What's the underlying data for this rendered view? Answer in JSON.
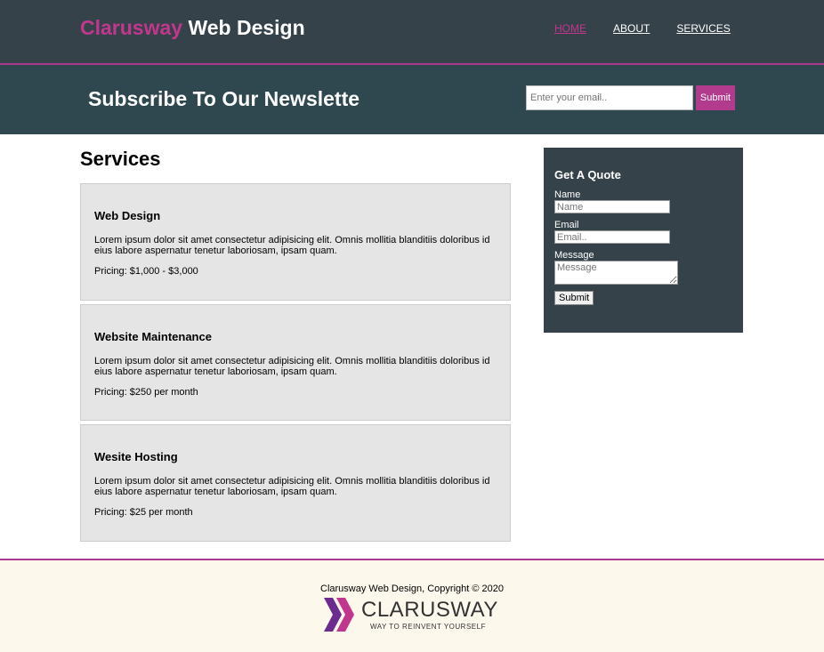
{
  "header": {
    "brand_accent": "Clarusway",
    "brand_rest": " Web Design",
    "nav": [
      {
        "label": "HOME",
        "active": true
      },
      {
        "label": "ABOUT",
        "active": false
      },
      {
        "label": "SERVICES",
        "active": false
      }
    ]
  },
  "newsletter": {
    "title": "Subscribe To Our Newslette",
    "placeholder": "Enter your email..",
    "submit_label": "Submit"
  },
  "services": {
    "title": "Services",
    "items": [
      {
        "name": "Web Design",
        "description": "Lorem ipsum dolor sit amet consectetur adipisicing elit. Omnis mollitia blanditiis doloribus id eius labore aspernatur tenetur laboriosam, ipsam quam.",
        "pricing": "Pricing: $1,000 - $3,000"
      },
      {
        "name": "Website Maintenance",
        "description": "Lorem ipsum dolor sit amet consectetur adipisicing elit. Omnis mollitia blanditiis doloribus id eius labore aspernatur tenetur laboriosam, ipsam quam.",
        "pricing": "Pricing: $250 per month"
      },
      {
        "name": "Wesite Hosting",
        "description": "Lorem ipsum dolor sit amet consectetur adipisicing elit. Omnis mollitia blanditiis doloribus id eius labore aspernatur tenetur laboriosam, ipsam quam.",
        "pricing": "Pricing: $25 per month"
      }
    ]
  },
  "quote": {
    "title": "Get A Quote",
    "name_label": "Name",
    "name_placeholder": "Name",
    "email_label": "Email",
    "email_placeholder": "Email..",
    "message_label": "Message",
    "message_placeholder": "Message",
    "submit_label": "Submit"
  },
  "footer": {
    "copyright": "Clarusway Web Design, Copyright © 2020",
    "logo_text": "CLARUSWAY",
    "logo_tagline": "WAY TO REINVENT YOURSELF"
  },
  "colors": {
    "header_bg": "#35424a",
    "accent": "#c2378e",
    "newsletter_bg": "#2f474e",
    "card_bg": "#e5e5e5",
    "footer_bg": "#fdf8ec"
  }
}
